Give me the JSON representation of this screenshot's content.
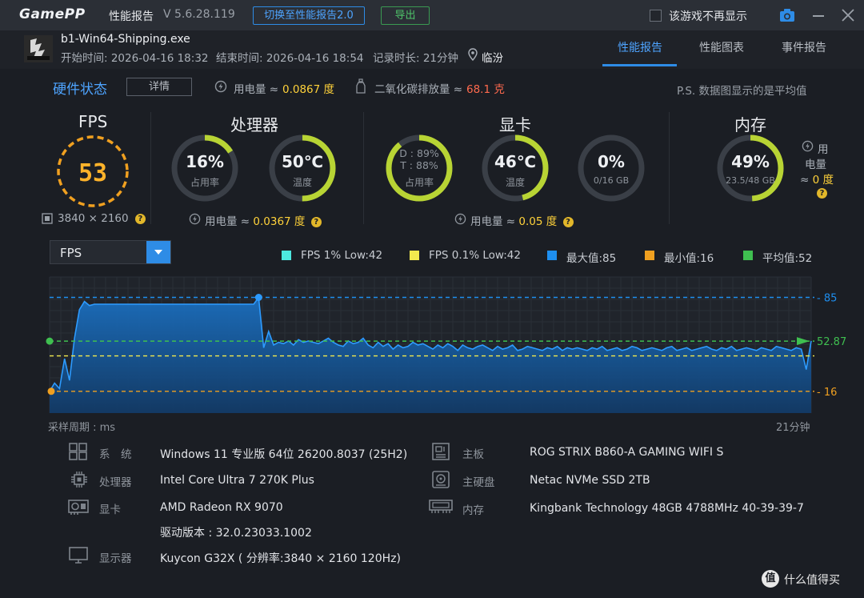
{
  "window": {
    "logo": "GamePP",
    "title": "性能报告",
    "version": "V 5.6.28.119",
    "switch_button": "切换至性能报告2.0",
    "export_button": "导出",
    "no_show_label": "该游戏不再显示"
  },
  "session": {
    "process_name": "b1-Win64-Shipping.exe",
    "start_time": "开始时间: 2026-04-16 18:32",
    "end_time": "结束时间: 2026-04-16 18:54",
    "duration": "记录时长: 21分钟",
    "location": "临汾"
  },
  "tabs": [
    {
      "label": "性能报告",
      "active": true
    },
    {
      "label": "性能图表",
      "active": false
    },
    {
      "label": "事件报告",
      "active": false
    }
  ],
  "hardware": {
    "title": "硬件状态",
    "detail_button": "详情",
    "power_label": "用电量 ≈",
    "power_value": "0.0867 度",
    "co2_label": "二氧化碳排放量 ≈",
    "co2_value": "68.1 克",
    "note": "P.S. 数据图显示的是平均值",
    "fps": {
      "title": "FPS",
      "value": "53",
      "resolution": "3840 × 2160"
    },
    "cpu": {
      "title": "处理器",
      "usage": "16%",
      "usage_label": "占用率",
      "usage_pct": 16,
      "temp": "50℃",
      "temp_label": "温度",
      "temp_pct": 50,
      "power_label": "用电量 ≈",
      "power_value": "0.0367 度"
    },
    "gpu": {
      "title": "显卡",
      "d_usage": "D : 89%",
      "t_usage": "T : 88%",
      "usage_label": "占用率",
      "usage_pct": 89,
      "temp": "46℃",
      "temp_label": "温度",
      "temp_pct": 46,
      "vram": "0%",
      "vram_detail": "0/16 GB",
      "vram_pct": 0,
      "power_label": "用电量 ≈",
      "power_value": "0.05 度"
    },
    "memory": {
      "title": "内存",
      "usage": "49%",
      "usage_detail": "23.5/48 GB",
      "usage_pct": 49,
      "power_line1": "用",
      "power_line2": "电量",
      "power_prefix": "≈",
      "power_value": "0 度"
    }
  },
  "chart": {
    "selector_label": "FPS",
    "legend": [
      {
        "label": "FPS 1% Low:42",
        "color": "#4de8e0"
      },
      {
        "label": "FPS 0.1% Low:42",
        "color": "#f2e94e"
      },
      {
        "label": "最大值:85",
        "color": "#1e8ff0"
      },
      {
        "label": "最小值:16",
        "color": "#f0a020"
      },
      {
        "label": "平均值:52",
        "color": "#3fbf50"
      }
    ],
    "x_caption_left": "采样周期 : ms",
    "x_caption_right": "21分钟"
  },
  "chart_data": {
    "type": "area",
    "title": "",
    "xlabel": "采样周期 : ms",
    "ylabel": "",
    "ylim": [
      0,
      100
    ],
    "reference_lines": [
      {
        "name": "最大值",
        "value": 85,
        "label": "85",
        "color": "#1e8ff0"
      },
      {
        "name": "平均值",
        "value": 52.87,
        "label": "52.87",
        "color": "#3fbf50"
      },
      {
        "name": "1% Low",
        "value": 42,
        "color": "#f2e94e"
      },
      {
        "name": "最小值",
        "value": 16,
        "label": "16",
        "color": "#f0a020"
      }
    ],
    "series": [
      {
        "values": [
          16,
          22,
          18,
          40,
          24,
          55,
          76,
          82,
          79,
          80,
          80,
          80,
          80,
          80,
          80,
          80,
          80,
          80,
          80,
          80,
          80,
          80,
          80,
          80,
          80,
          80,
          80,
          80,
          80,
          80,
          80,
          80,
          80,
          80,
          80,
          80,
          80,
          80,
          80,
          80,
          80,
          80,
          85,
          48,
          60,
          50,
          52,
          51,
          53,
          50,
          54,
          52,
          53,
          52,
          51,
          53,
          55,
          52,
          50,
          49,
          53,
          51,
          52,
          55,
          50,
          48,
          52,
          49,
          51,
          47,
          50,
          48,
          49,
          52,
          50,
          51,
          49,
          47,
          50,
          48,
          51,
          49,
          46,
          50,
          48,
          47,
          49,
          50,
          48,
          46,
          49,
          47,
          48,
          50,
          46,
          47,
          49,
          48,
          47,
          46,
          48,
          47,
          49,
          46,
          48,
          47,
          48,
          47,
          46,
          48,
          47,
          49,
          46,
          47,
          48,
          46,
          47,
          49,
          48,
          46,
          47,
          48,
          47,
          46,
          48,
          49,
          46,
          47,
          48,
          46,
          47,
          48,
          49,
          47,
          46,
          48,
          47,
          49,
          46,
          47,
          48,
          47,
          46,
          48,
          47,
          46,
          49,
          48,
          47,
          46,
          48,
          47,
          32,
          53
        ]
      }
    ]
  },
  "system": [
    {
      "label": "系　统",
      "value": "Windows 11 专业版 64位 26200.8037 (25H2)",
      "icon": "windows-icon"
    },
    {
      "label": "处理器",
      "value": "Intel Core Ultra 7 270K Plus",
      "icon": "cpu-icon"
    },
    {
      "label": "显卡",
      "value": "AMD Radeon RX 9070",
      "icon": "gpu-icon"
    },
    {
      "label": "",
      "value": "驱动版本 : 32.0.23033.1002",
      "icon": ""
    },
    {
      "label": "显示器",
      "value": "Kuycon G32X ( 分辨率:3840 × 2160 120Hz)",
      "icon": "monitor-icon"
    },
    {
      "label": "主板",
      "value": "ROG STRIX B860-A GAMING WIFI S",
      "icon": "motherboard-icon"
    },
    {
      "label": "主硬盘",
      "value": "Netac NVMe SSD 2TB",
      "icon": "disk-icon"
    },
    {
      "label": "内存",
      "value": "Kingbank Technology 48GB 4788MHz 40-39-39-7",
      "icon": "ram-icon"
    }
  ],
  "watermark": {
    "badge": "值",
    "text": "什么值得买"
  }
}
